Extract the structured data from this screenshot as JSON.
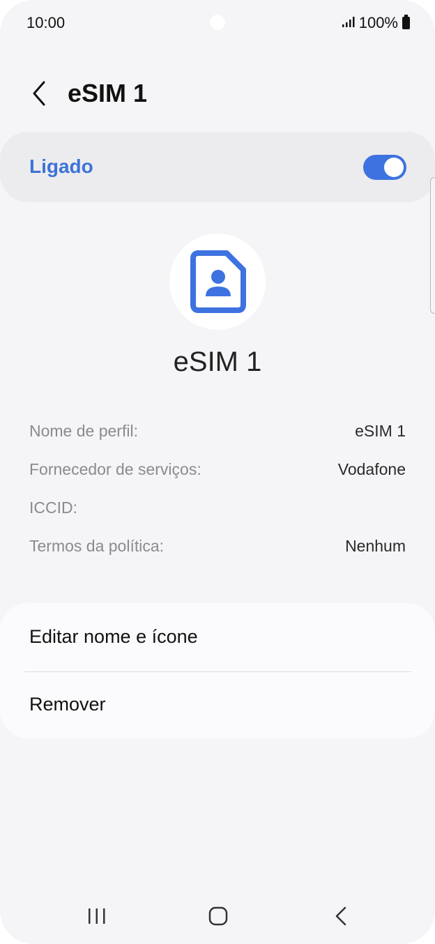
{
  "status_bar": {
    "time": "10:00",
    "signal_icon": "signal-bars-icon",
    "battery_text": "100%",
    "battery_icon": "battery-icon"
  },
  "header": {
    "back_icon": "chevron-left-icon",
    "title": "eSIM 1"
  },
  "toggle": {
    "label": "Ligado",
    "state": "on",
    "accent_color": "#3e72e0"
  },
  "profile": {
    "icon": "contact-card-icon",
    "icon_color": "#3e72e0",
    "name": "eSIM 1"
  },
  "details": [
    {
      "label": "Nome de perfil:",
      "value": "eSIM 1"
    },
    {
      "label": "Fornecedor de serviços:",
      "value": "Vodafone"
    },
    {
      "label": "ICCID:",
      "value": ""
    },
    {
      "label": "Termos da política:",
      "value": "Nenhum"
    }
  ],
  "actions": {
    "edit_label": "Editar nome e ícone",
    "remove_label": "Remover"
  },
  "nav_bar": {
    "recents_icon": "recents-icon",
    "home_icon": "home-icon",
    "back_icon": "back-icon"
  }
}
